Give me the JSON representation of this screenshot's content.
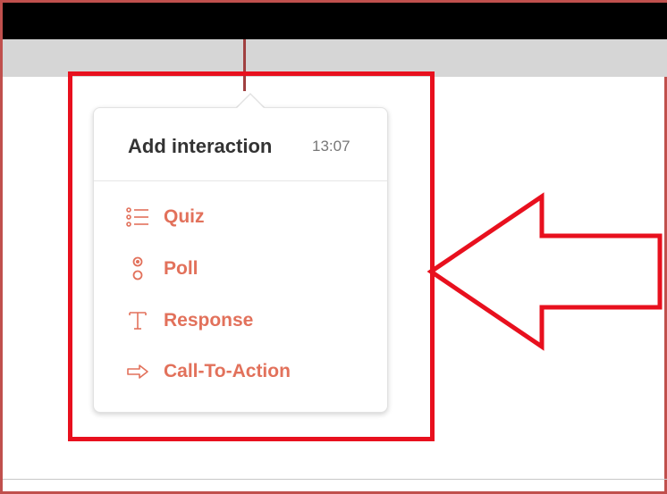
{
  "popover": {
    "title": "Add interaction",
    "time": "13:07",
    "items": [
      {
        "label": "Quiz",
        "icon": "list-icon"
      },
      {
        "label": "Poll",
        "icon": "poll-icon"
      },
      {
        "label": "Response",
        "icon": "text-t-icon"
      },
      {
        "label": "Call-To-Action",
        "icon": "arrow-right-icon"
      }
    ]
  },
  "colors": {
    "accent": "#e2715b",
    "highlight_red": "#e8101e",
    "top_bar": "#000000",
    "gray_bar": "#d6d6d6"
  },
  "annotation": {
    "box_icon": "highlight-box",
    "arrow_icon": "left-pointing-arrow"
  }
}
